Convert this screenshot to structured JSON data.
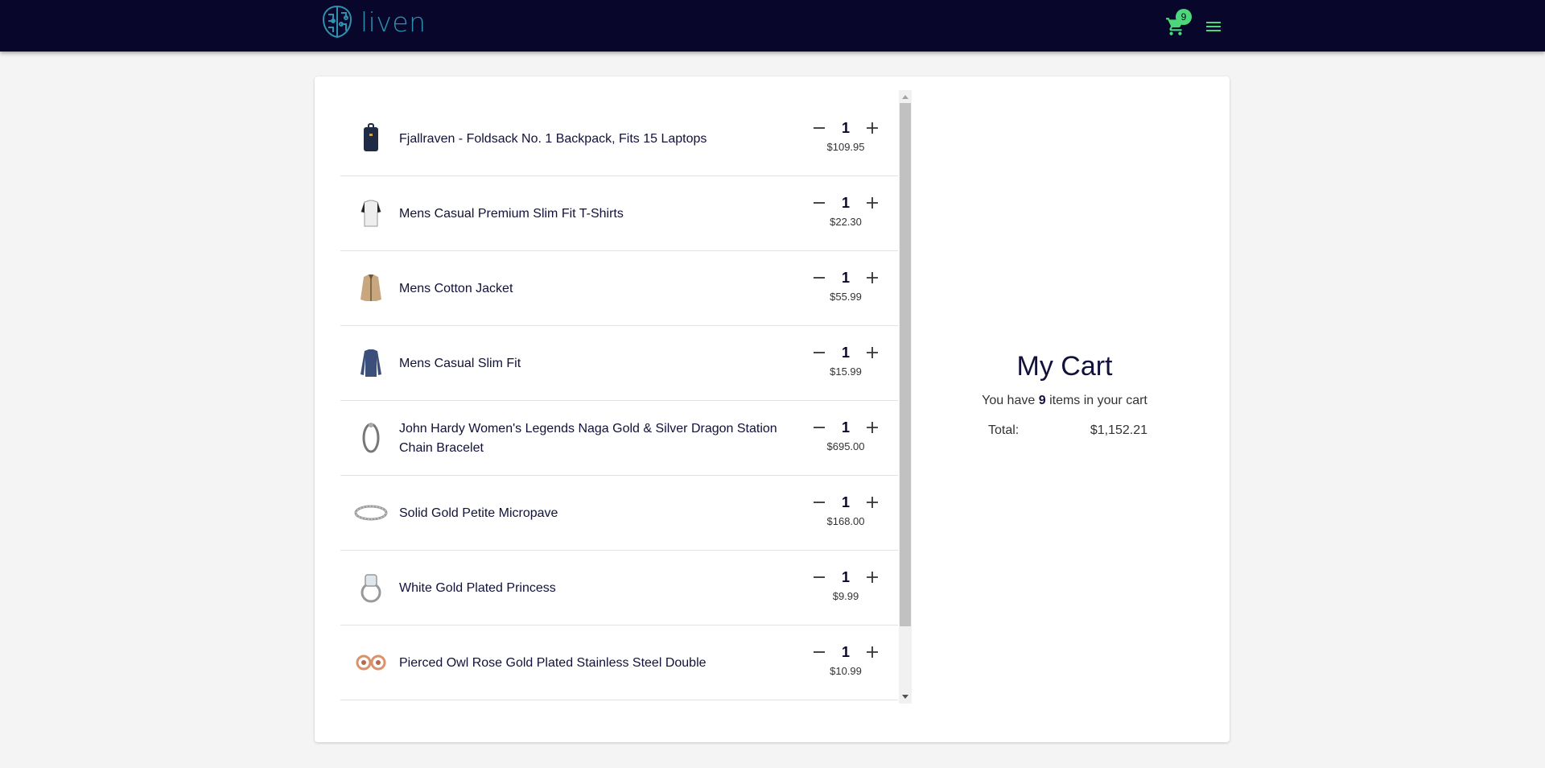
{
  "app": {
    "brand": "liven",
    "cart_badge": "9"
  },
  "colors": {
    "header_bg": "#08062a",
    "accent": "#4cd87a",
    "logo": "#2f8fae"
  },
  "cart_items": [
    {
      "title": "Fjallraven - Foldsack No. 1 Backpack, Fits 15 Laptops",
      "qty": "1",
      "price": "$109.95",
      "icon": "backpack-image"
    },
    {
      "title": "Mens Casual Premium Slim Fit T-Shirts",
      "qty": "1",
      "price": "$22.30",
      "icon": "tshirt-image"
    },
    {
      "title": "Mens Cotton Jacket",
      "qty": "1",
      "price": "$55.99",
      "icon": "jacket-image"
    },
    {
      "title": "Mens Casual Slim Fit",
      "qty": "1",
      "price": "$15.99",
      "icon": "longsleeve-image"
    },
    {
      "title": "John Hardy Women's Legends Naga Gold & Silver Dragon Station Chain Bracelet",
      "qty": "1",
      "price": "$695.00",
      "icon": "bracelet-image"
    },
    {
      "title": "Solid Gold Petite Micropave",
      "qty": "1",
      "price": "$168.00",
      "icon": "ring-band-image"
    },
    {
      "title": "White Gold Plated Princess",
      "qty": "1",
      "price": "$9.99",
      "icon": "diamond-ring-image"
    },
    {
      "title": "Pierced Owl Rose Gold Plated Stainless Steel Double",
      "qty": "1",
      "price": "$10.99",
      "icon": "earrings-image"
    }
  ],
  "summary": {
    "title": "My Cart",
    "count_prefix": "You have",
    "count": "9",
    "count_suffix": "items in your cart",
    "total_label": "Total:",
    "total_value": "$1,152.21"
  }
}
